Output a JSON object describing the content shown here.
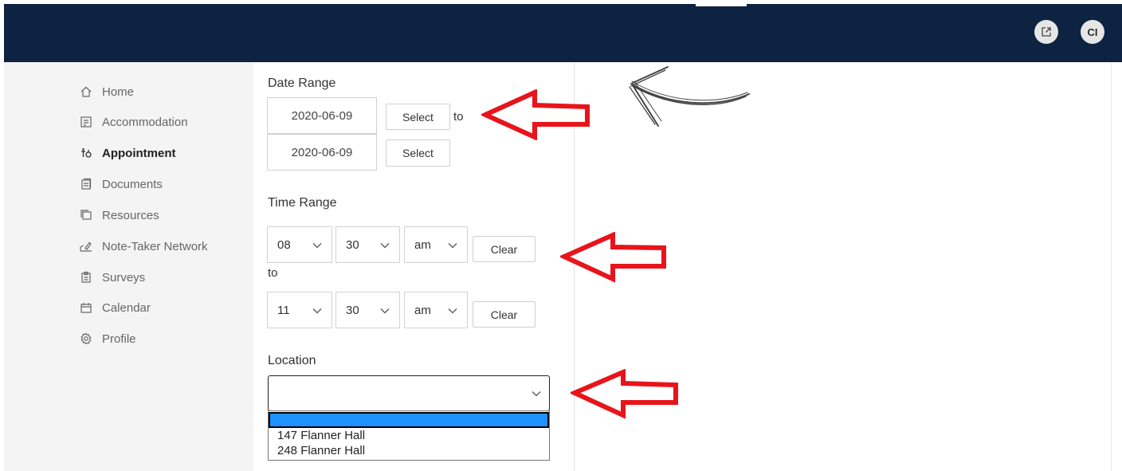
{
  "header": {
    "open_external_icon": "external-link-icon",
    "avatar_initials": "CI"
  },
  "sidebar": {
    "items": [
      {
        "label": "Home",
        "icon": "home-icon",
        "active": false
      },
      {
        "label": "Accommodation",
        "icon": "list-icon",
        "active": false
      },
      {
        "label": "Appointment",
        "icon": "appointment-icon",
        "active": true
      },
      {
        "label": "Documents",
        "icon": "documents-icon",
        "active": false
      },
      {
        "label": "Resources",
        "icon": "resources-icon",
        "active": false
      },
      {
        "label": "Note-Taker Network",
        "icon": "note-taker-icon",
        "active": false
      },
      {
        "label": "Surveys",
        "icon": "surveys-icon",
        "active": false
      },
      {
        "label": "Calendar",
        "icon": "calendar-icon",
        "active": false
      },
      {
        "label": "Profile",
        "icon": "gear-icon",
        "active": false
      }
    ]
  },
  "form": {
    "date_range": {
      "label": "Date Range",
      "start": "2020-06-09",
      "end": "2020-06-09",
      "select_label": "Select",
      "to_label": "to"
    },
    "time_range": {
      "label": "Time Range",
      "start": {
        "hour": "08",
        "minute": "30",
        "period": "am"
      },
      "end": {
        "hour": "11",
        "minute": "30",
        "period": "am"
      },
      "clear_label": "Clear",
      "to_label": "to"
    },
    "location": {
      "label": "Location",
      "value": "",
      "options": [
        "",
        "147 Flanner Hall",
        "248 Flanner Hall"
      ]
    }
  },
  "colors": {
    "topbar": "#0e2241",
    "sidebar_bg": "#f4f4f4",
    "highlight_option": "#1e90ff",
    "annotation_arrow": "#e8141b"
  }
}
